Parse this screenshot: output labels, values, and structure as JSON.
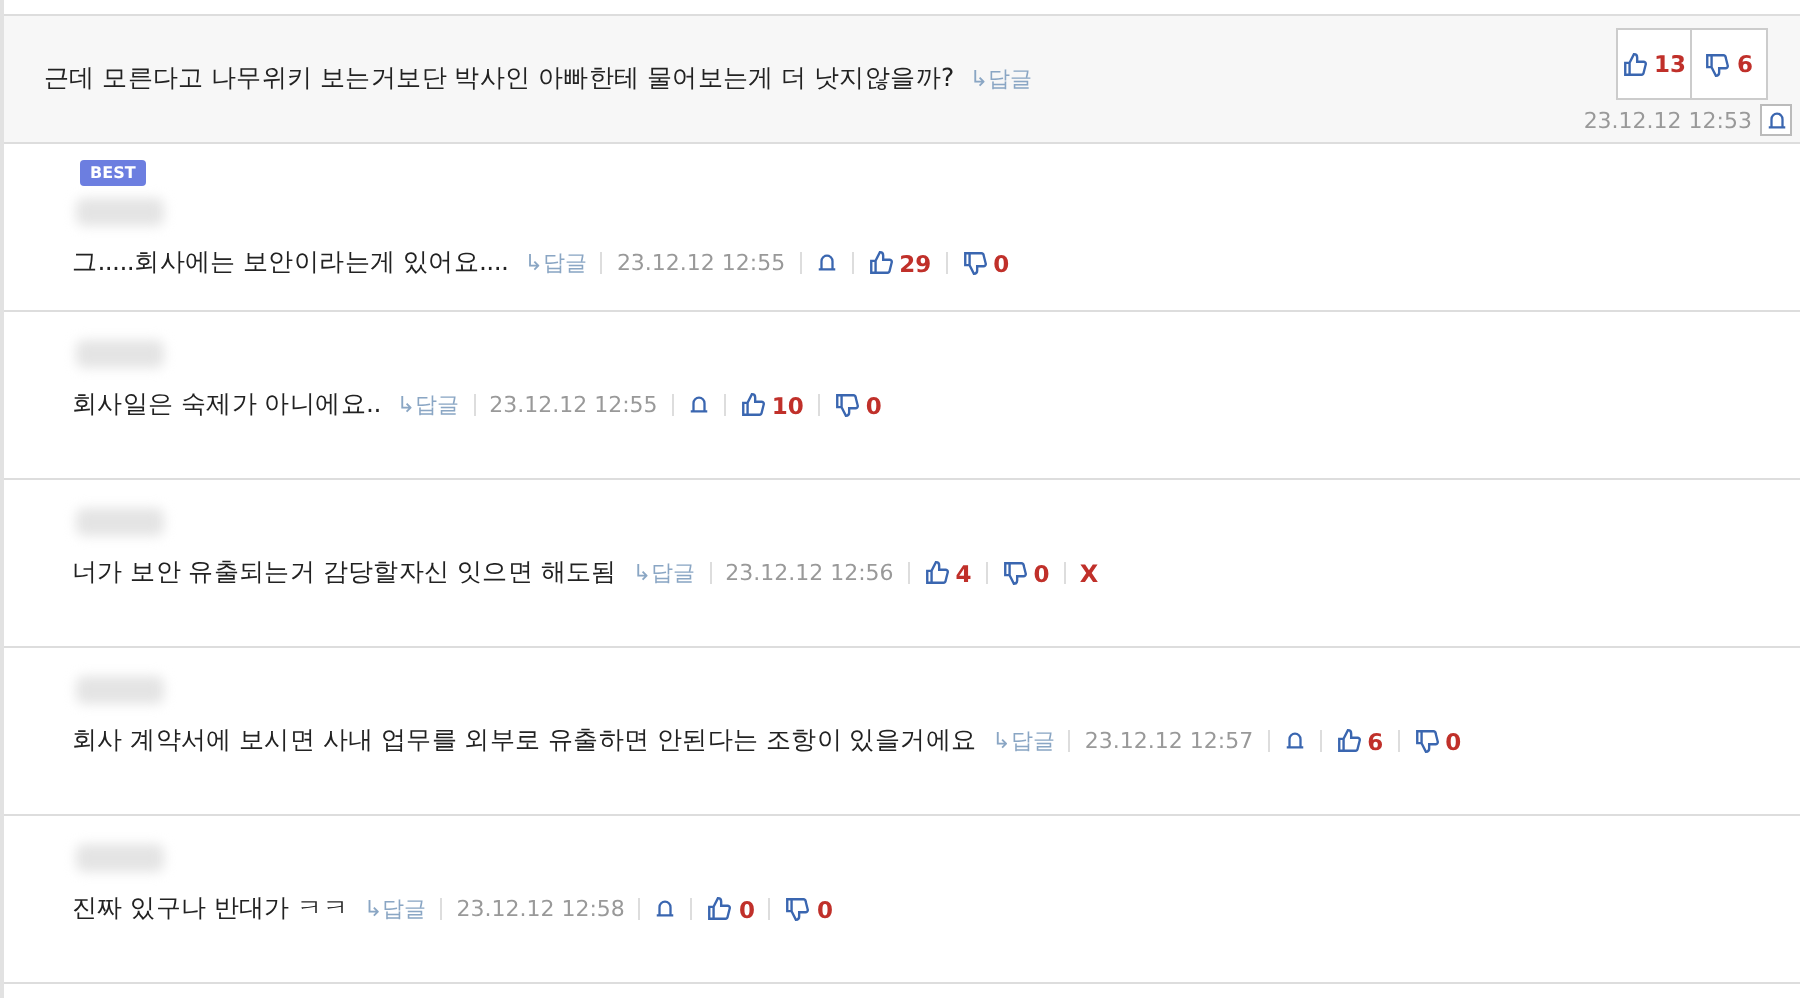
{
  "top_comment": {
    "text": "근데 모른다고 나무위키 보는거보단 박사인 아빠한테 물어보는게 더 낫지않을까?",
    "reply_label": "↳답글",
    "likes": "13",
    "dislikes": "6",
    "time": "23.12.12 12:53",
    "report": true
  },
  "replies": [
    {
      "best_label": "BEST",
      "text": "그.....회사에는 보안이라는게 있어요....",
      "reply_label": "↳답글",
      "time": "23.12.12 12:55",
      "report": true,
      "likes": "29",
      "dislikes": "0"
    },
    {
      "text": "회사일은 숙제가 아니에요..",
      "reply_label": "↳답글",
      "time": "23.12.12 12:55",
      "report": true,
      "likes": "10",
      "dislikes": "0"
    },
    {
      "text": "너가 보안 유출되는거 감당할자신 잇으면 해도됨",
      "reply_label": "↳답글",
      "time": "23.12.12 12:56",
      "report": false,
      "likes": "4",
      "dislikes": "0",
      "delete_label": "X"
    },
    {
      "text": "회사 계약서에 보시면 사내 업무를 외부로 유출하면 안된다는 조항이 있을거에요",
      "reply_label": "↳답글",
      "time": "23.12.12 12:57",
      "report": true,
      "likes": "6",
      "dislikes": "0"
    },
    {
      "text": "진짜 있구나 반대가 ㅋㅋ",
      "reply_label": "↳답글",
      "time": "23.12.12 12:58",
      "report": true,
      "likes": "0",
      "dislikes": "0"
    }
  ]
}
